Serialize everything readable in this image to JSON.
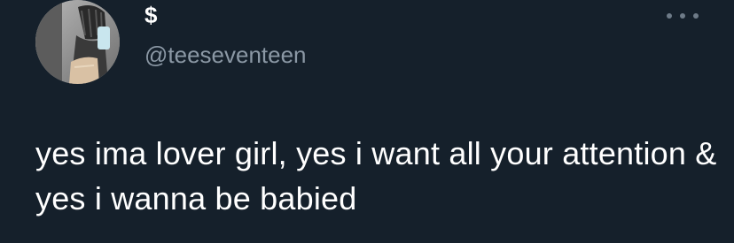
{
  "tweet": {
    "display_name": "$",
    "handle": "@teeseventeen",
    "text": "yes ima lover girl, yes i want all your attention & yes i wanna be babied",
    "more_icon": "more-horizontal-icon"
  },
  "colors": {
    "background": "#15202b",
    "name": "#ffffff",
    "handle": "#8b98a5",
    "body_text": "#ffffff"
  }
}
